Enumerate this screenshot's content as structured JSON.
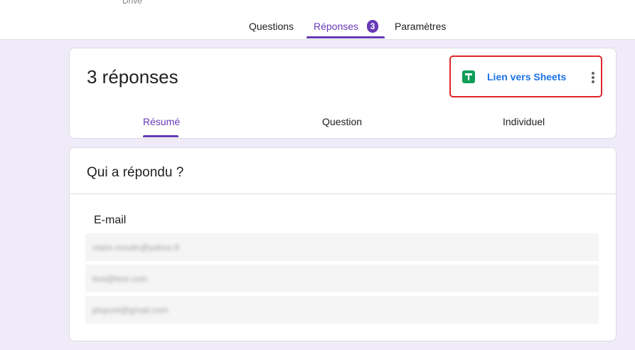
{
  "header": {
    "drive_label": "Drive",
    "tabs": [
      {
        "label": "Questions"
      },
      {
        "label": "Réponses",
        "badge": "3"
      },
      {
        "label": "Paramètres"
      }
    ]
  },
  "summary_card": {
    "title": "3 réponses",
    "sheets_link": "Lien vers Sheets",
    "subtabs": [
      {
        "label": "Résumé"
      },
      {
        "label": "Question"
      },
      {
        "label": "Individuel"
      }
    ]
  },
  "respondents_card": {
    "title": "Qui a répondu ?",
    "column_header": "E-mail",
    "emails": [
      "claire.moulin@yahoo.fr",
      "test@test.com",
      "jdupont@gmail.com"
    ]
  },
  "colors": {
    "accent": "#673ab7",
    "link": "#1a73e8",
    "sheets_green": "#0f9d58",
    "highlight_border": "#e0262a",
    "background": "#f0ebf8"
  }
}
